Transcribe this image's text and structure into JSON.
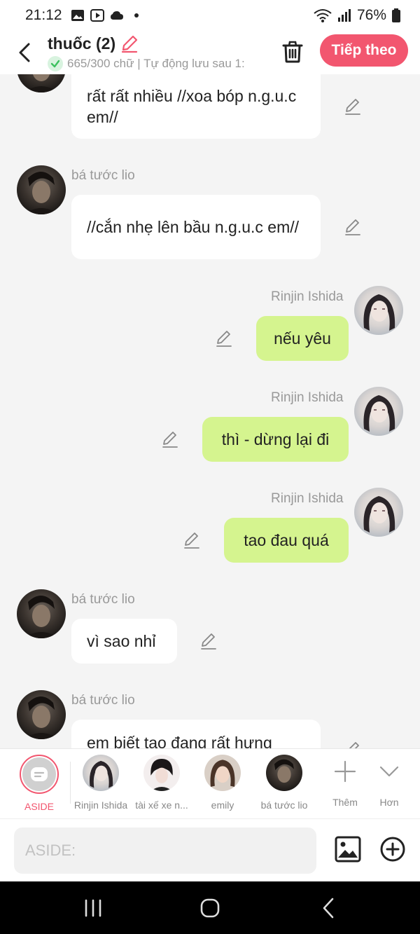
{
  "status_bar": {
    "time": "21:12",
    "battery": "76%"
  },
  "header": {
    "title": "thuốc (2)",
    "subtitle": "665/300 chữ | Tự động lưu sau 1:",
    "next_label": "Tiếp theo"
  },
  "messages": [
    {
      "side": "in",
      "sender": "",
      "text": "rất rất nhiều //xoa bóp n.g.u.c em//"
    },
    {
      "side": "in",
      "sender": "bá tước lio",
      "text": "//cắn nhẹ lên bầu n.g.u.c em//"
    },
    {
      "side": "out",
      "sender": "Rinjin Ishida",
      "text": "nếu yêu"
    },
    {
      "side": "out",
      "sender": "Rinjin Ishida",
      "text": "thì - dừng lại đi"
    },
    {
      "side": "out",
      "sender": "Rinjin Ishida",
      "text": "tao đau quá"
    },
    {
      "side": "in",
      "sender": "bá tước lio",
      "text": "vì sao nhỉ"
    },
    {
      "side": "in",
      "sender": "bá tước lio",
      "text": "em biết tao đang rất hưng"
    }
  ],
  "characters": [
    {
      "label": "ASIDE"
    },
    {
      "label": "Rinjin Ishida"
    },
    {
      "label": "tài xế xe n..."
    },
    {
      "label": "emily"
    },
    {
      "label": "bá tước lio"
    },
    {
      "label": "Thêm"
    },
    {
      "label": "Hơn"
    }
  ],
  "input": {
    "placeholder": "ASIDE:"
  },
  "colors": {
    "accent": "#f2566f",
    "outgoing_bubble": "#d5f48f",
    "incoming_bubble": "#ffffff",
    "background": "#f4f4f4"
  },
  "icons": [
    "back-icon",
    "pencil-icon",
    "check-icon",
    "trash-icon",
    "edit-icon",
    "plus-icon",
    "chevron-down-icon",
    "image-icon",
    "add-circle-icon",
    "recents-icon",
    "home-icon",
    "nav-back-icon"
  ]
}
